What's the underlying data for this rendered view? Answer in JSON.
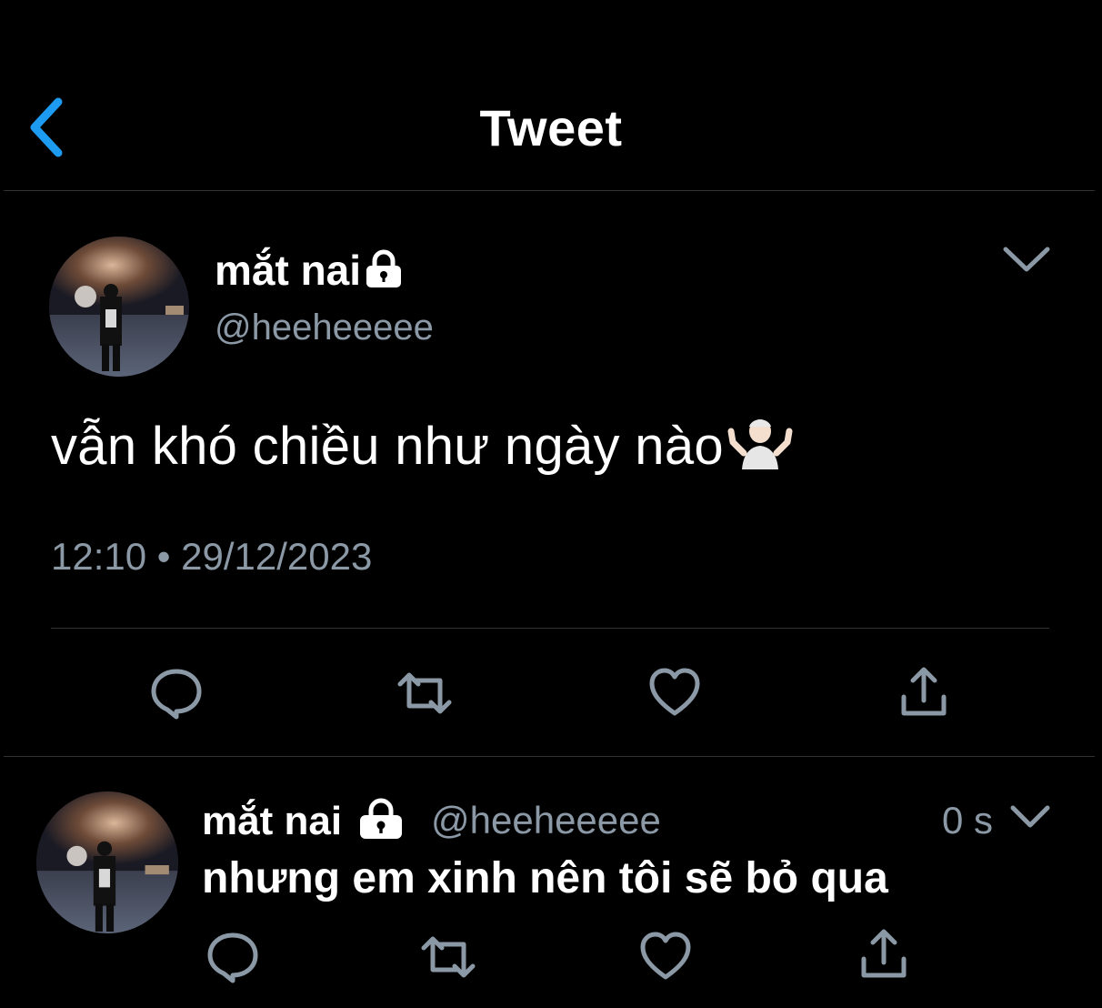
{
  "header": {
    "title": "Tweet",
    "back_icon": "chevron-left-icon",
    "accent_color": "#1d9bf0"
  },
  "main_tweet": {
    "author": {
      "display_name": "mắt nai",
      "handle": "@heeheeeee",
      "protected_icon": "lock-icon"
    },
    "text": "vẫn khó chiều như ngày nào",
    "emoji": "person-shrugging-emoji",
    "timestamp": "12:10 • 29/12/2023",
    "actions": [
      "reply-icon",
      "retweet-icon",
      "like-icon",
      "share-icon"
    ]
  },
  "reply_tweet": {
    "author": {
      "display_name": "mắt nai",
      "handle": "@heeheeeee",
      "protected_icon": "lock-icon"
    },
    "time": "0 s",
    "text": "nhưng em xinh nên tôi sẽ bỏ qua",
    "actions": [
      "reply-icon",
      "retweet-icon",
      "like-icon",
      "share-icon"
    ]
  },
  "colors": {
    "background": "#000000",
    "text": "#ffffff",
    "secondary_text": "#8b98a5",
    "divider": "#2f3336",
    "icon": "#8b98a5"
  }
}
